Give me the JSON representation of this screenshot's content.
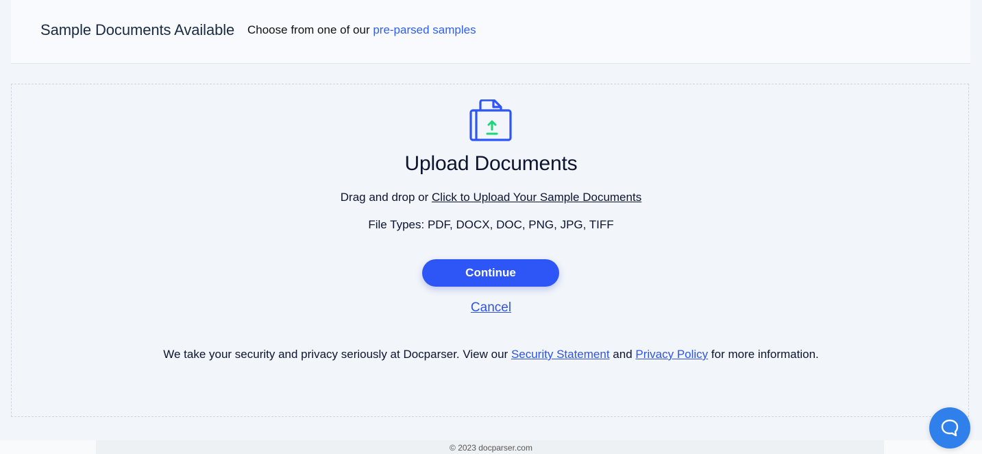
{
  "header": {
    "title": "Sample Documents Available",
    "subtitle_prefix": "Choose from one of our ",
    "samples_link": "pre-parsed samples"
  },
  "upload": {
    "icon": "folder-upload-icon",
    "title": "Upload Documents",
    "drag_prefix": "Drag and drop or ",
    "click_link": "Click to Upload Your Sample Documents",
    "file_types": "File Types: PDF, DOCX, DOC, PNG, JPG, TIFF",
    "continue_label": "Continue",
    "cancel_label": "Cancel"
  },
  "security": {
    "prefix": "We take your security and privacy seriously at Docparser. View our ",
    "security_link": "Security Statement",
    "middle": " and ",
    "privacy_link": "Privacy Policy",
    "suffix": " for more information."
  },
  "footer": {
    "copyright": "© 2023 docparser.com"
  },
  "chat": {
    "icon": "chat-bubble-icon"
  },
  "colors": {
    "accent": "#2e55f5",
    "link": "#2f55e0",
    "upload_arrow": "#1ed67a",
    "chat": "#2f80ea"
  }
}
